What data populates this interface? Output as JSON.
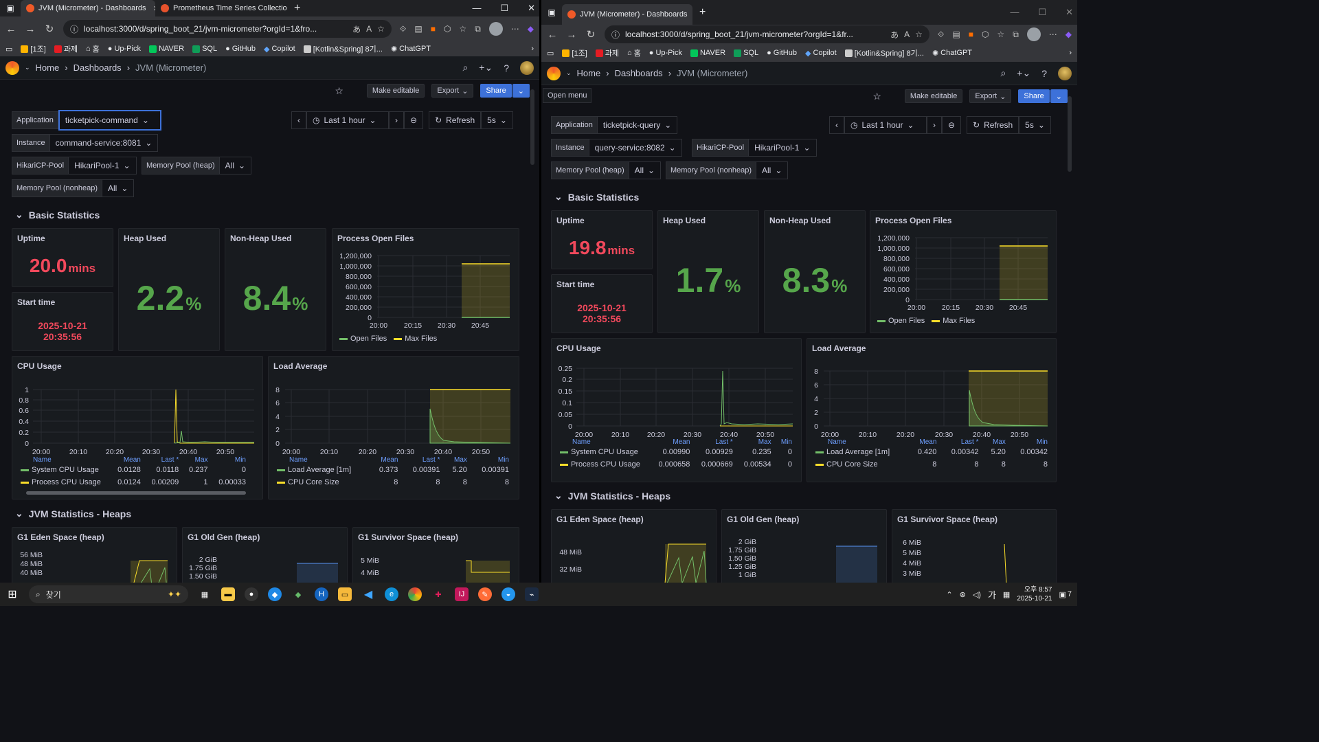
{
  "left": {
    "tabs": [
      {
        "title": "JVM (Micrometer) - Dashboards",
        "active": true
      },
      {
        "title": "Prometheus Time Series Collectio",
        "active": false
      }
    ],
    "url": "localhost:3000/d/spring_boot_21/jvm-micrometer?orgId=1&fro...",
    "variables": {
      "application": {
        "label": "Application",
        "value": "ticketpick-command"
      },
      "instance": {
        "label": "Instance",
        "value": "command-service:8081"
      },
      "hikari": {
        "label": "HikariCP-Pool",
        "value": "HikariPool-1"
      },
      "heap": {
        "label": "Memory Pool (heap)",
        "value": "All"
      },
      "nonheap": {
        "label": "Memory Pool (nonheap)",
        "value": "All"
      }
    },
    "stats": {
      "uptime_value": "20.0",
      "uptime_unit": "mins",
      "start_date": "2025-10-21",
      "start_time": "20:35:56",
      "heap_value": "2.2",
      "nonheap_value": "8.4"
    },
    "cpu_table": [
      {
        "name": "System CPU Usage",
        "mean": "0.0128",
        "last": "0.0118",
        "max": "0.237",
        "min": "0"
      },
      {
        "name": "Process CPU Usage",
        "mean": "0.0124",
        "last": "0.00209",
        "max": "1",
        "min": "0.00033"
      }
    ],
    "load_table": [
      {
        "name": "Load Average [1m]",
        "mean": "0.373",
        "last": "0.00391",
        "max": "5.20",
        "min": "0.00391"
      },
      {
        "name": "CPU Core Size",
        "mean": "8",
        "last": "8",
        "max": "8",
        "min": "8"
      }
    ]
  },
  "right": {
    "tabs": [
      {
        "title": "JVM (Micrometer) - Dashboards",
        "active": true
      }
    ],
    "url": "localhost:3000/d/spring_boot_21/jvm-micrometer?orgId=1&fr...",
    "open_menu": "Open menu",
    "variables": {
      "application": {
        "label": "Application",
        "value": "ticketpick-query"
      },
      "instance": {
        "label": "Instance",
        "value": "query-service:8082"
      },
      "hikari": {
        "label": "HikariCP-Pool",
        "value": "HikariPool-1"
      },
      "heap": {
        "label": "Memory Pool (heap)",
        "value": "All"
      },
      "nonheap": {
        "label": "Memory Pool (nonheap)",
        "value": "All"
      }
    },
    "stats": {
      "uptime_value": "19.8",
      "uptime_unit": "mins",
      "start_date": "2025-10-21",
      "start_time": "20:35:56",
      "heap_value": "1.7",
      "nonheap_value": "8.3"
    },
    "cpu_table": [
      {
        "name": "System CPU Usage",
        "mean": "0.00990",
        "last": "0.00929",
        "max": "0.235",
        "min": "0"
      },
      {
        "name": "Process CPU Usage",
        "mean": "0.000658",
        "last": "0.000669",
        "max": "0.00534",
        "min": "0"
      }
    ],
    "load_table": [
      {
        "name": "Load Average [1m]",
        "mean": "0.420",
        "last": "0.00342",
        "max": "5.20",
        "min": "0.00342"
      },
      {
        "name": "CPU Core Size",
        "mean": "8",
        "last": "8",
        "max": "8",
        "min": "8"
      }
    ]
  },
  "common": {
    "bookmarks": [
      "[1조]",
      "과제",
      "홈",
      "Up-Pick",
      "NAVER",
      "SQL",
      "GitHub",
      "Copilot",
      "[Kotlin&Spring] 8기...",
      "ChatGPT"
    ],
    "breadcrumb": {
      "home": "Home",
      "dashboards": "Dashboards",
      "current": "JVM (Micrometer)"
    },
    "buttons": {
      "make_editable": "Make editable",
      "export": "Export",
      "share": "Share"
    },
    "time": {
      "range": "Last 1 hour",
      "refresh": "Refresh",
      "interval": "5s"
    },
    "rows": {
      "basic": "Basic Statistics",
      "heaps": "JVM Statistics - Heaps"
    },
    "panels": {
      "uptime": "Uptime",
      "start": "Start time",
      "heap": "Heap Used",
      "nonheap": "Non-Heap Used",
      "openfiles": "Process Open Files",
      "cpu": "CPU Usage",
      "load": "Load Average",
      "eden": "G1 Eden Space (heap)",
      "old": "G1 Old Gen (heap)",
      "survivor": "G1 Survivor Space (heap)"
    },
    "percent": "%",
    "legend": {
      "open_files": "Open Files",
      "max_files": "Max Files"
    },
    "table_headers": {
      "name": "Name",
      "mean": "Mean",
      "last": "Last *",
      "max": "Max",
      "min": "Min"
    },
    "taskbar": {
      "search": "찾기",
      "ampm": "오후 8:57",
      "date": "2025-10-21",
      "ime": "가",
      "notify": "7"
    },
    "colors": {
      "green": "#73bf69",
      "yellow": "#fade2a",
      "red": "#f2495c",
      "blue": "#3d71d9"
    }
  },
  "chart_data": [
    {
      "type": "area",
      "title": "Process Open Files",
      "x_ticks": [
        "20:00",
        "20:15",
        "20:30",
        "20:45"
      ],
      "y_ticks": [
        "0",
        "200,000",
        "400,000",
        "600,000",
        "800,000",
        "1,000,000",
        "1,200,000"
      ],
      "series": [
        {
          "name": "Open Files",
          "values": [
            0
          ]
        },
        {
          "name": "Max Files",
          "values": [
            1048576
          ]
        }
      ]
    },
    {
      "type": "line",
      "title": "CPU Usage",
      "x_ticks": [
        "20:00",
        "20:10",
        "20:20",
        "20:30",
        "20:40",
        "20:50"
      ],
      "y_ticks": [
        "0",
        "0.2",
        "0.4",
        "0.6",
        "0.8",
        "1"
      ],
      "series": [
        {
          "name": "System CPU Usage",
          "values": [
            0.237,
            0.0118
          ]
        },
        {
          "name": "Process CPU Usage",
          "values": [
            1,
            0.00209
          ]
        }
      ]
    },
    {
      "type": "line",
      "title": "Load Average",
      "x_ticks": [
        "20:00",
        "20:10",
        "20:20",
        "20:30",
        "20:40",
        "20:50"
      ],
      "y_ticks": [
        "0",
        "2",
        "4",
        "6",
        "8"
      ],
      "series": [
        {
          "name": "Load Average [1m]",
          "values": [
            5.2,
            0.00391
          ]
        },
        {
          "name": "CPU Core Size",
          "values": [
            8,
            8
          ]
        }
      ]
    }
  ]
}
